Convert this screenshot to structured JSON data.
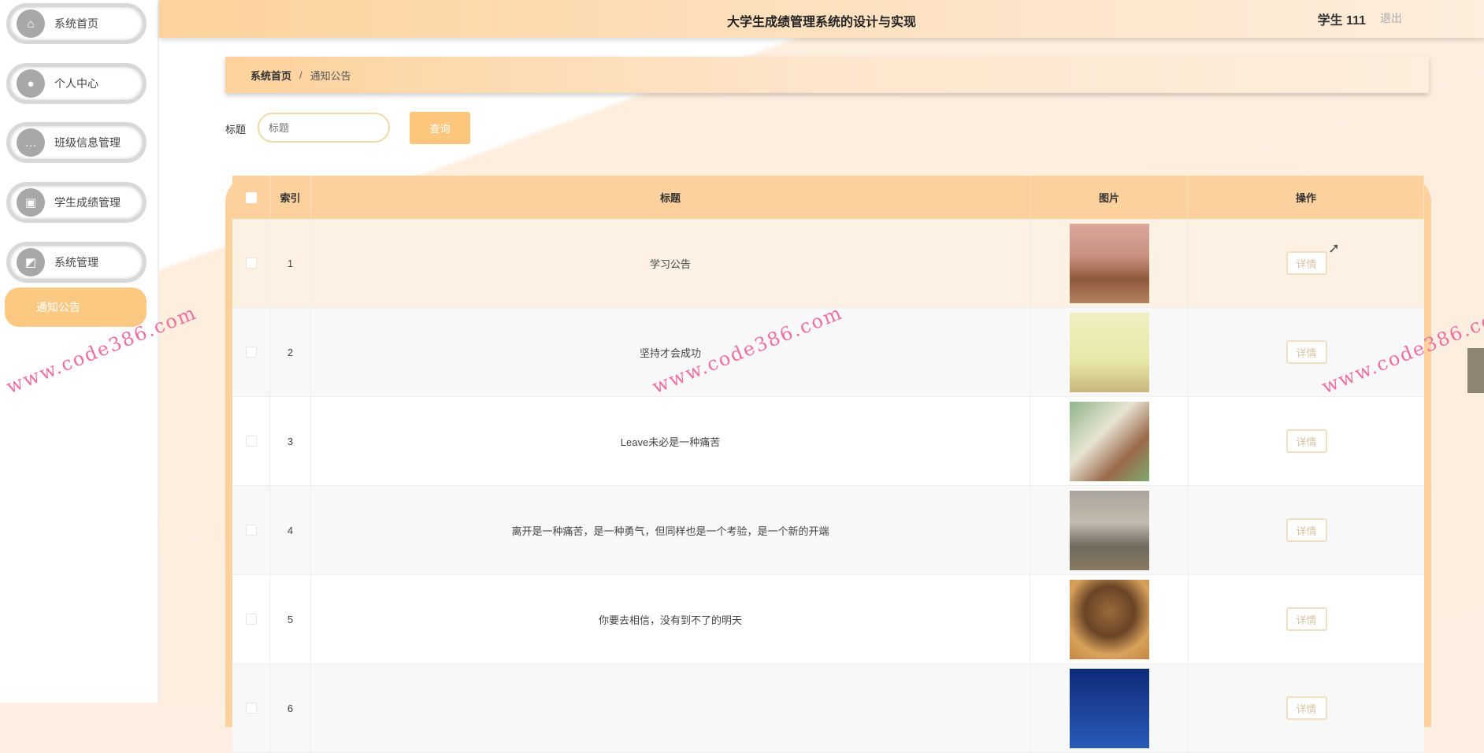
{
  "header": {
    "title": "大学生成绩管理系统的设计与实现",
    "user": "学生 111",
    "logout": "退出"
  },
  "sidebar": {
    "items": [
      {
        "label": "系统首页",
        "icon": "home-icon",
        "glyph": "⌂"
      },
      {
        "label": "个人中心",
        "icon": "user-icon",
        "glyph": "●"
      },
      {
        "label": "班级信息管理",
        "icon": "chat-icon",
        "glyph": "…"
      },
      {
        "label": "学生成绩管理",
        "icon": "briefcase-icon",
        "glyph": "▣"
      },
      {
        "label": "系统管理",
        "icon": "wallet-icon",
        "glyph": "◩"
      }
    ],
    "active_sub": "通知公告"
  },
  "breadcrumb": {
    "home": "系统首页",
    "sep": "/",
    "current": "通知公告"
  },
  "search": {
    "label": "标题",
    "placeholder": "标题",
    "button": "查询"
  },
  "table": {
    "headers": [
      "索引",
      "标题",
      "图片",
      "操作"
    ],
    "rows": [
      {
        "index": "1",
        "title": "学习公告",
        "action": "详情"
      },
      {
        "index": "2",
        "title": "坚持才会成功",
        "action": "详情"
      },
      {
        "index": "3",
        "title": "Leave未必是一种痛苦",
        "action": "详情"
      },
      {
        "index": "4",
        "title": "离开是一种痛苦，是一种勇气，但同样也是一个考验，是一个新的开端",
        "action": "详情"
      },
      {
        "index": "5",
        "title": "你要去相信，没有到不了的明天",
        "action": "详情"
      },
      {
        "index": "6",
        "title": "",
        "action": "详情"
      }
    ]
  },
  "watermark": "www.code386.com",
  "colors": {
    "accent": "#fcc77c",
    "header": "#fdd19d"
  }
}
